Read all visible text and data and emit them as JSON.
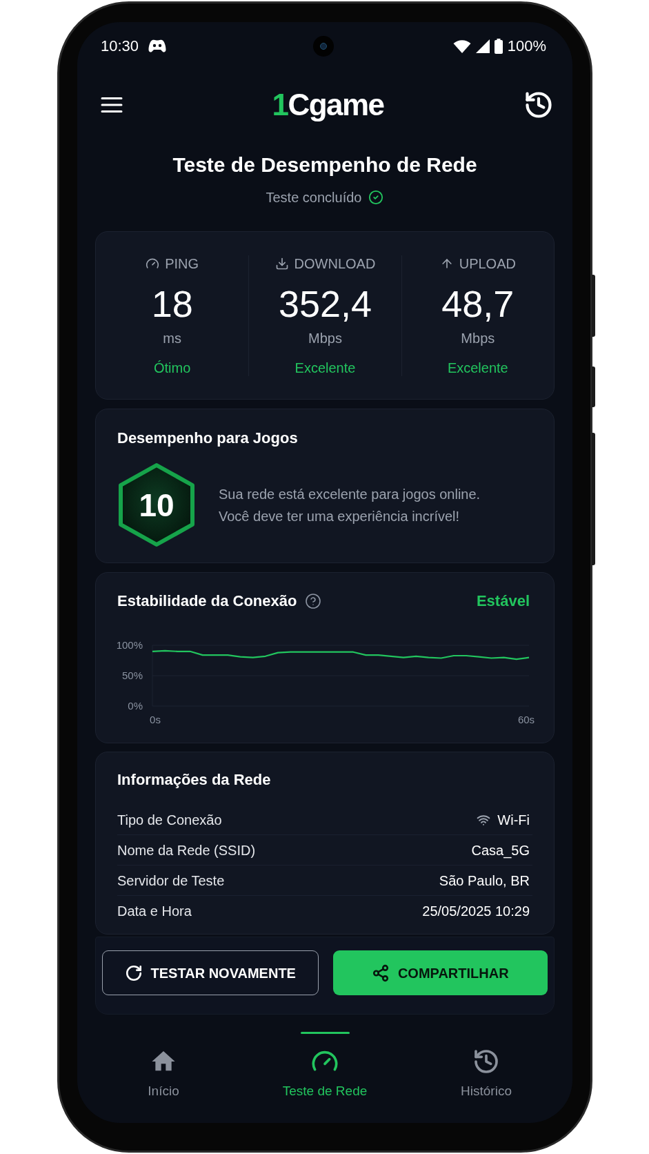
{
  "status_bar": {
    "time": "10:30",
    "battery": "100%"
  },
  "header": {
    "logo": "1Cgame"
  },
  "page": {
    "title": "Teste de Desempenho de Rede",
    "status": "Teste concluído"
  },
  "metrics": [
    {
      "label": "PING",
      "value": "18",
      "unit": "ms",
      "rating": "Ótimo"
    },
    {
      "label": "DOWNLOAD",
      "value": "352,4",
      "unit": "Mbps",
      "rating": "Excelente"
    },
    {
      "label": "UPLOAD",
      "value": "48,7",
      "unit": "Mbps",
      "rating": "Excelente"
    }
  ],
  "gaming": {
    "title": "Desempenho para Jogos",
    "score": "10",
    "description": [
      "Sua rede está excelente para jogos online.",
      "Você deve ter uma experiência incrível!"
    ]
  },
  "stability": {
    "title": "Estabilidade da Conexão",
    "status": "Estável",
    "chart_data": {
      "type": "line",
      "x": [
        0,
        2,
        4,
        6,
        8,
        10,
        12,
        14,
        16,
        18,
        20,
        22,
        24,
        26,
        28,
        30,
        32,
        34,
        36,
        38,
        40,
        42,
        44,
        46,
        48,
        50,
        52,
        54,
        56,
        58,
        60
      ],
      "series": [
        {
          "color": "#22c55e",
          "values": [
            90,
            91,
            90,
            90,
            84,
            84,
            84,
            81,
            80,
            82,
            88,
            89,
            89,
            89,
            89,
            89,
            89,
            84,
            84,
            82,
            80,
            82,
            80,
            79,
            83,
            83,
            81,
            79,
            80,
            77,
            80
          ]
        }
      ],
      "xlim": [
        0,
        60
      ],
      "ylim": [
        0,
        100
      ],
      "xticks": [
        {
          "value": 0,
          "label": "0s"
        },
        {
          "value": 60,
          "label": "60s"
        }
      ],
      "yticks": [
        {
          "value": 0,
          "label": "0%"
        },
        {
          "value": 50,
          "label": "50%"
        },
        {
          "value": 100,
          "label": "100%"
        }
      ]
    }
  },
  "network_info": {
    "title": "Informações da Rede",
    "rows": [
      {
        "kind": "with_icon",
        "label": "Tipo de Conexão",
        "value": "Wi-Fi"
      },
      {
        "kind": "text",
        "label": "Nome da Rede (SSID)",
        "value": "Casa_5G"
      },
      {
        "kind": "text",
        "label": "Servidor de Teste",
        "value": "São Paulo, BR"
      },
      {
        "kind": "text",
        "label": "Data e Hora",
        "value": "25/05/2025 10:29"
      }
    ]
  },
  "actions": [
    {
      "kind": "outline",
      "label": "TESTAR NOVAMENTE"
    },
    {
      "kind": "primary",
      "label": "COMPARTILHAR"
    }
  ],
  "bottom_nav": [
    {
      "label": "Início",
      "selected": false
    },
    {
      "label": "Teste de Rede",
      "selected": true
    },
    {
      "label": "Histórico",
      "selected": false
    }
  ]
}
